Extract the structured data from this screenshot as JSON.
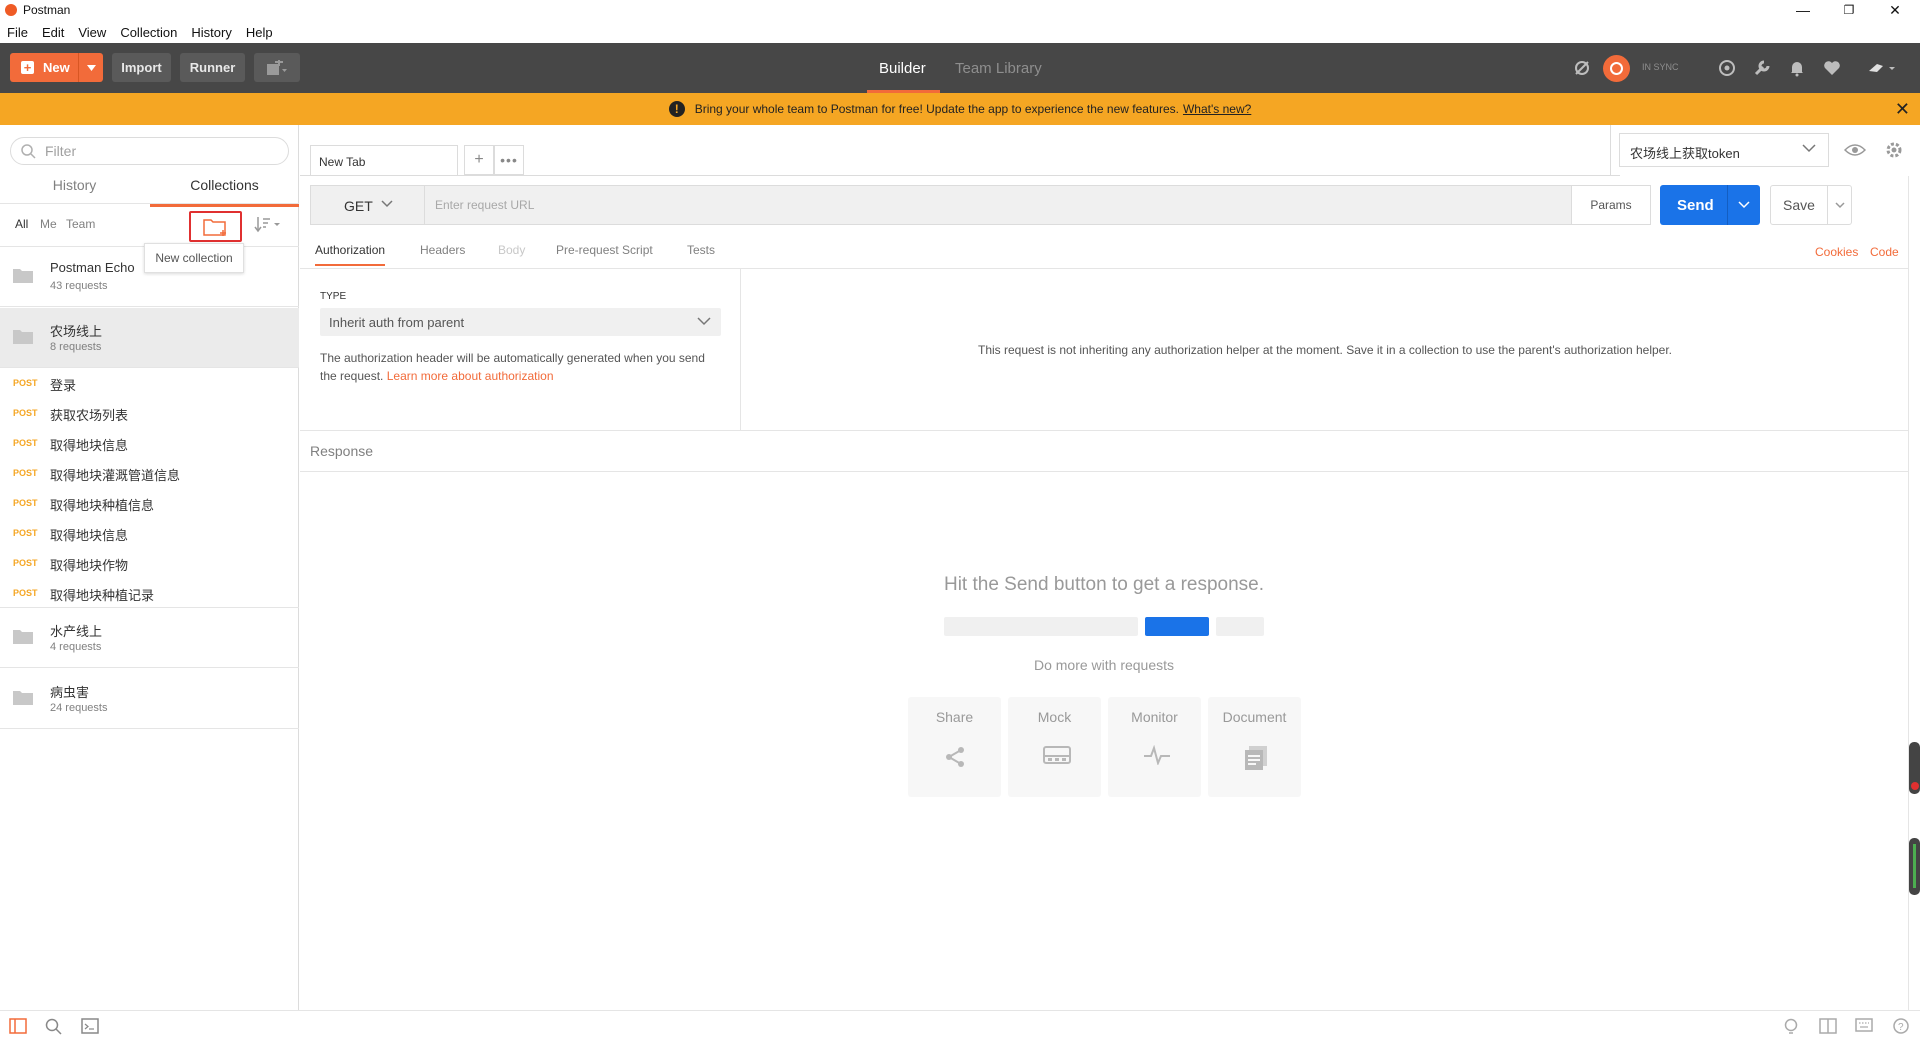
{
  "window": {
    "title": "Postman",
    "minimize": "—",
    "restore": "❐",
    "close": "✕"
  },
  "menu": [
    "File",
    "Edit",
    "View",
    "Collection",
    "History",
    "Help"
  ],
  "header": {
    "new_label": "New",
    "import_label": "Import",
    "runner_label": "Runner",
    "tabs": {
      "builder": "Builder",
      "team_library": "Team Library"
    },
    "sync_status": "IN SYNC"
  },
  "banner": {
    "text": "Bring your whole team to Postman for free! Update the app to experience the new features.",
    "link": "What's new?"
  },
  "sidebar": {
    "filter_placeholder": "Filter",
    "tabs": {
      "history": "History",
      "collections": "Collections"
    },
    "filters": {
      "all": "All",
      "me": "Me",
      "team": "Team"
    },
    "tooltip": "New collection",
    "collections": [
      {
        "name": "Postman Echo",
        "count": "43 requests"
      },
      {
        "name": "农场线上",
        "count": "8 requests"
      },
      {
        "name": "水产线上",
        "count": "4 requests"
      },
      {
        "name": "病虫害",
        "count": "24 requests"
      }
    ],
    "requests": [
      {
        "method": "POST",
        "name": "登录"
      },
      {
        "method": "POST",
        "name": "获取农场列表"
      },
      {
        "method": "POST",
        "name": "取得地块信息"
      },
      {
        "method": "POST",
        "name": "取得地块灌溉管道信息"
      },
      {
        "method": "POST",
        "name": "取得地块种植信息"
      },
      {
        "method": "POST",
        "name": "取得地块信息"
      },
      {
        "method": "POST",
        "name": "取得地块作物"
      },
      {
        "method": "POST",
        "name": "取得地块种植记录"
      }
    ]
  },
  "main": {
    "tab_label": "New Tab",
    "environment": "农场线上获取token",
    "method": "GET",
    "url_placeholder": "Enter request URL",
    "params_label": "Params",
    "send_label": "Send",
    "save_label": "Save",
    "request_tabs": {
      "authorization": "Authorization",
      "headers": "Headers",
      "body": "Body",
      "prerequest": "Pre-request Script",
      "tests": "Tests"
    },
    "cookies_label": "Cookies",
    "code_label": "Code",
    "auth": {
      "type_label": "TYPE",
      "type_value": "Inherit auth from parent",
      "description": "The authorization header will be automatically generated when you send the request.",
      "learn_more": "Learn more about authorization",
      "right_message": "This request is not inheriting any authorization helper at the moment. Save it in a collection to use the parent's authorization helper."
    },
    "response_label": "Response",
    "empty_title": "Hit the Send button to get a response.",
    "do_more": "Do more with requests",
    "cards": [
      "Share",
      "Mock",
      "Monitor",
      "Document"
    ]
  },
  "colors": {
    "accent": "#f26b3a",
    "send": "#1a73e8",
    "banner": "#f5a623",
    "header": "#474747",
    "post": "#f5a623"
  }
}
